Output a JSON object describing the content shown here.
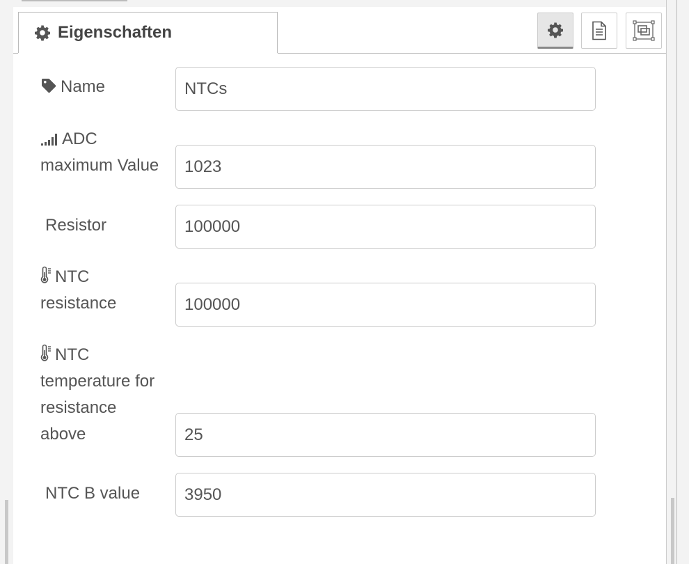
{
  "tab": {
    "label": "Eigenschaften",
    "icon": "gear-icon"
  },
  "toolbar": [
    {
      "name": "properties-button",
      "icon": "gear-icon",
      "active": true
    },
    {
      "name": "description-button",
      "icon": "document-icon",
      "active": false
    },
    {
      "name": "appearance-button",
      "icon": "node-appearance-icon",
      "active": false
    }
  ],
  "form": {
    "name": {
      "label": "Name",
      "icon": "tag-icon",
      "value": "NTCs"
    },
    "adc_max": {
      "label_line1": "ADC",
      "label_line2": "maximum Value",
      "icon": "signal-bars-icon",
      "value": "1023"
    },
    "resistor": {
      "label": "Resistor",
      "value": "100000"
    },
    "ntc_resistance": {
      "label_line1": "NTC",
      "label_line2": "resistance",
      "icon": "thermometer-icon",
      "value": "100000"
    },
    "ntc_temperature": {
      "label_line1": "NTC",
      "label_line2": "temperature for",
      "label_line3": "resistance",
      "label_line4": "above",
      "icon": "thermometer-icon",
      "value": "25"
    },
    "ntc_b_value": {
      "label": "NTC B value",
      "value": "3950"
    }
  }
}
